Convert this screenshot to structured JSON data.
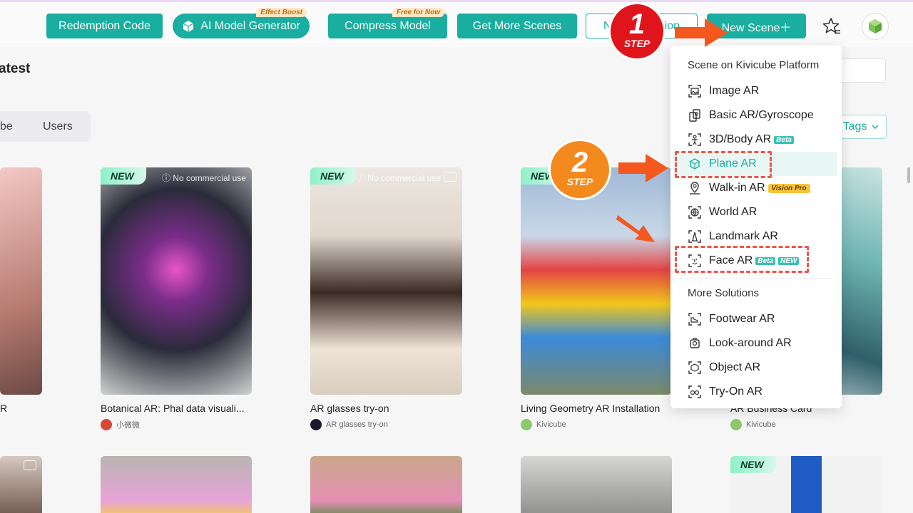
{
  "toolbar": {
    "redemption_code": "Redemption Code",
    "ai_model_generator": "AI Model Generator",
    "ai_badge": "Effect Boost",
    "compress_model": "Compress Model",
    "compress_badge": "Free for Now",
    "get_more_scenes": "Get More Scenes",
    "new_collection_partial": "N",
    "new_collection_tail": "ion",
    "new_scene": "New Scene＋"
  },
  "page": {
    "title": "atest",
    "tab_left": "be",
    "tab_users": "Users",
    "tags": "Tags"
  },
  "steps": [
    {
      "num": "1",
      "label": "STEP"
    },
    {
      "num": "2",
      "label": "STEP"
    }
  ],
  "dropdown": {
    "section1": "Scene on Kivicube Platform",
    "items1": [
      {
        "label": "Image AR",
        "icon": "image-ar-icon"
      },
      {
        "label": "Basic AR/Gyroscope",
        "icon": "gyroscope-icon"
      },
      {
        "label": "3D/Body AR",
        "icon": "body-ar-icon",
        "tag": "Beta"
      },
      {
        "label": "Plane AR",
        "icon": "plane-ar-icon"
      },
      {
        "label": "Walk-in AR",
        "icon": "walk-in-icon",
        "tag": "Vision Pro"
      },
      {
        "label": "World AR",
        "icon": "world-icon"
      },
      {
        "label": "Landmark AR",
        "icon": "landmark-icon"
      },
      {
        "label": "Face AR",
        "icon": "face-ar-icon",
        "tag": "Beta",
        "tag2": "NEW"
      }
    ],
    "section2": "More Solutions",
    "items2": [
      {
        "label": "Footwear AR",
        "icon": "footwear-icon"
      },
      {
        "label": "Look-around AR",
        "icon": "look-around-icon"
      },
      {
        "label": "Object AR",
        "icon": "object-ar-icon"
      },
      {
        "label": "Try-On AR",
        "icon": "try-on-icon"
      }
    ]
  },
  "cards": [
    {
      "title": "R",
      "author": ""
    },
    {
      "title": "Botanical AR: Phal data visuali...",
      "author": "小微微",
      "badge": "NEW",
      "note": "ⓘ No commercial use"
    },
    {
      "title": "AR glasses try-on",
      "author": "AR glasses try-on",
      "badge": "NEW",
      "note": "ⓘ No commercial use"
    },
    {
      "title": "Living Geometry AR Installation",
      "author": "Kivicube",
      "badge": "NEW"
    },
    {
      "title": "AR Business Card",
      "author": "Kivicube"
    }
  ],
  "row2": [
    {
      "badge": ""
    },
    {
      "badge": ""
    },
    {
      "badge": ""
    },
    {
      "badge": ""
    },
    {
      "badge": "NEW"
    }
  ],
  "colors": {
    "accent": "#1aaea0",
    "step1": "#e0141b",
    "step2": "#f4891e",
    "arrow": "#f4581e",
    "highlight": "#e8574c"
  }
}
